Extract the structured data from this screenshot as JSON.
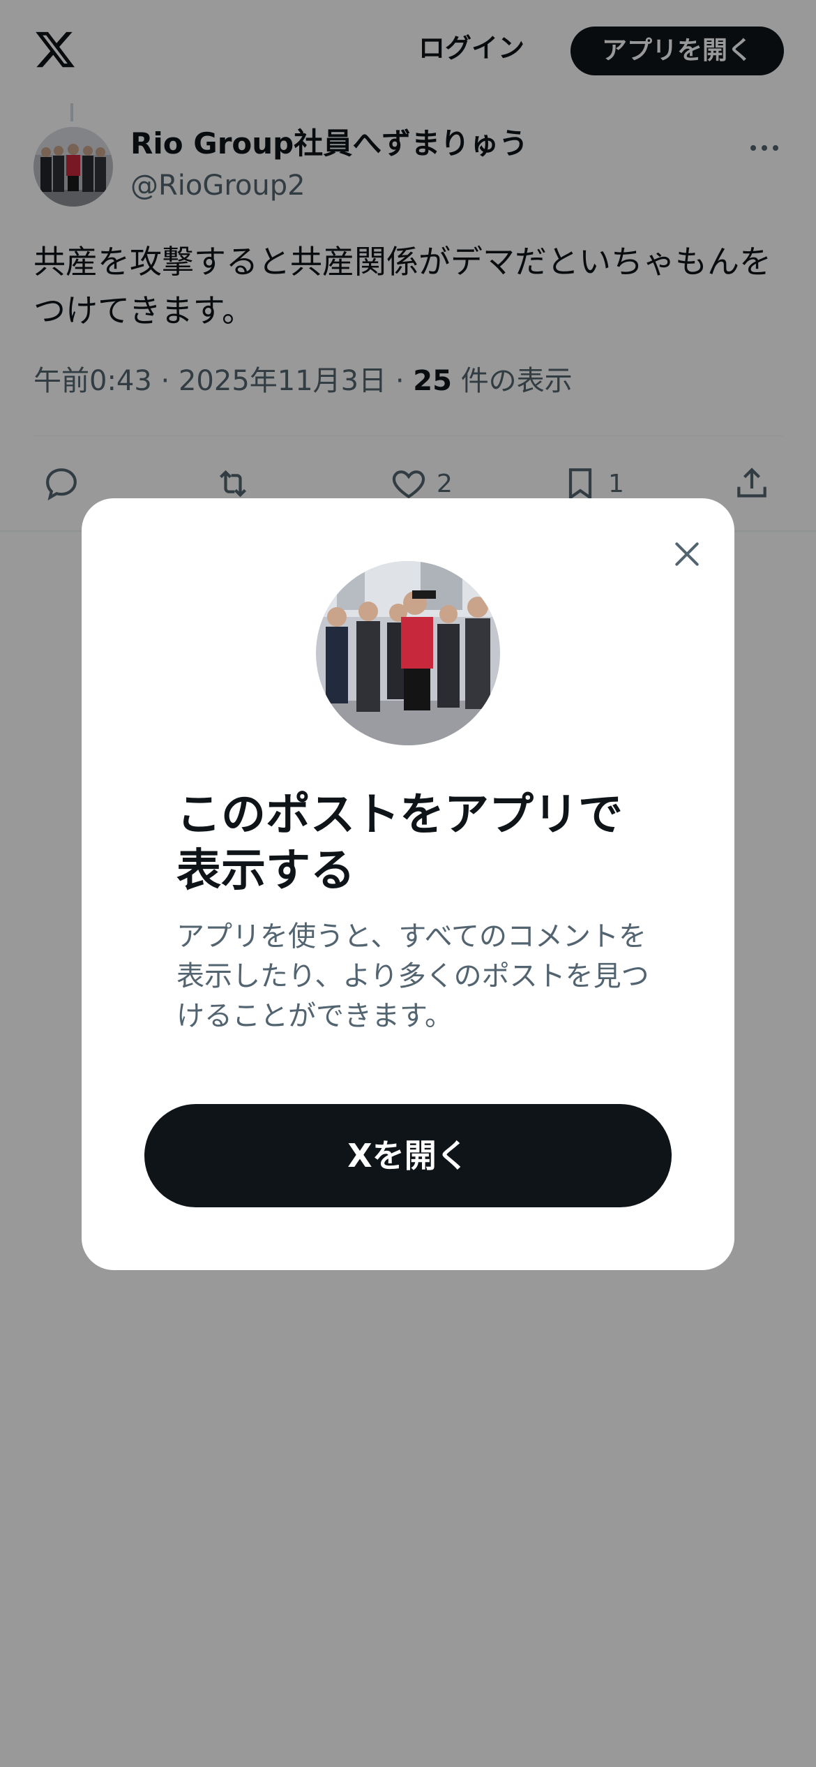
{
  "header": {
    "logo_icon": "x-logo-icon",
    "login_label": "ログイン",
    "open_app_label": "アプリを開く"
  },
  "post": {
    "author": {
      "display_name": "Rio Group社員へずまりゅう",
      "handle": "@RioGroup2"
    },
    "text": "共産を攻撃すると共産関係がデマだといちゃもんをつけてきます。",
    "time": "午前0:43",
    "separator": "·",
    "date": "2025年11月3日",
    "views_count": "25",
    "views_label": "件の表示",
    "actions": {
      "reply_icon": "reply-icon",
      "repost_icon": "repost-icon",
      "like_icon": "heart-icon",
      "like_count": "2",
      "bookmark_icon": "bookmark-icon",
      "bookmark_count": "1",
      "share_icon": "share-icon"
    }
  },
  "modal": {
    "close_icon": "close-icon",
    "title": "このポストをアプリで表示する",
    "description": "アプリを使うと、すべてのコメントを表示したり、より多くのポストを見つけることができます。",
    "button_label": "Xを開く"
  },
  "colors": {
    "primary_text": "#0f1419",
    "secondary_text": "#536471",
    "button_bg": "#0f1419",
    "overlay": "rgba(0,0,0,0.4)"
  }
}
